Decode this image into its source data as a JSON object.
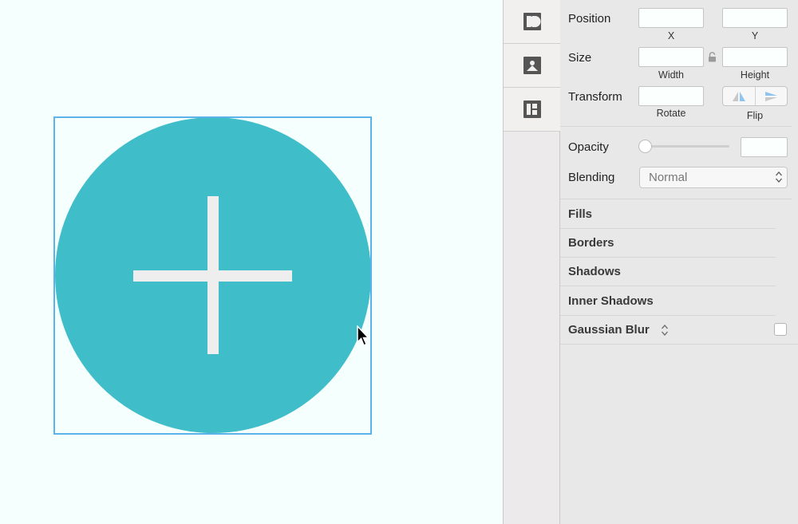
{
  "canvas": {
    "shape": {
      "fill": "#3fbdc8",
      "icon": "plus-icon"
    },
    "selection_color": "#5ab4ea"
  },
  "tool_strip": {
    "items": [
      {
        "icon": "dribbble-export-icon"
      },
      {
        "icon": "image-upload-icon"
      },
      {
        "icon": "symbol-panel-icon"
      }
    ]
  },
  "inspector": {
    "position": {
      "label": "Position",
      "x_label": "X",
      "y_label": "Y",
      "x_value": "",
      "y_value": ""
    },
    "size": {
      "label": "Size",
      "width_label": "Width",
      "height_label": "Height",
      "width_value": "",
      "height_value": ""
    },
    "transform": {
      "label": "Transform",
      "rotate_label": "Rotate",
      "flip_label": "Flip",
      "rotate_value": ""
    },
    "opacity": {
      "label": "Opacity",
      "value": "",
      "slider_fraction": 0
    },
    "blending": {
      "label": "Blending",
      "selected": "Normal"
    },
    "sections": {
      "fills": "Fills",
      "borders": "Borders",
      "shadows": "Shadows",
      "inner_shadows": "Inner Shadows",
      "gaussian_blur": "Gaussian Blur"
    }
  }
}
